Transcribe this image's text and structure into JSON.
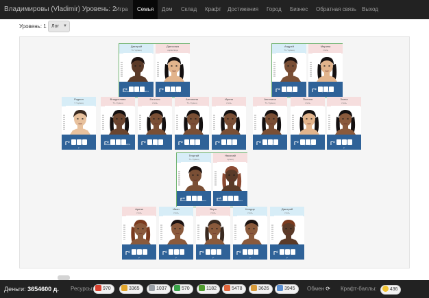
{
  "nav": {
    "brand": "Владимировы (Vladimir) Уровень: 2",
    "items": [
      "Игра",
      "Семья",
      "Дом",
      "Склад",
      "Крафт",
      "Достижения",
      "Город",
      "Бизнес",
      "Обратная связь",
      "Выход"
    ],
    "active": "Семья"
  },
  "level": {
    "label": "Уровень: 1",
    "select_value": "Лог"
  },
  "family": {
    "members": [
      {
        "name": "Дмитрий",
        "status": "71 / кузнец",
        "gender": "male",
        "skin": "#5a3a28",
        "hair": "#1b1210",
        "age": "Г°",
        "job": "Незнакомствовать вместе",
        "job2": ""
      },
      {
        "name": "Джессика",
        "status": "кормилица",
        "gender": "female",
        "skin": "#e2b48c",
        "hair": "#141010",
        "age": "Г°",
        "job": "Незнакомая(1)",
        "job2": ""
      },
      {
        "name": "Андрей",
        "status": "71 / кузнец",
        "gender": "male",
        "skin": "#7a4f35",
        "hair": "#1b1210",
        "age": "Г°",
        "job": "кузнец(1)",
        "job2": ""
      },
      {
        "name": "Марина",
        "status": "стиль",
        "gender": "female",
        "skin": "#e2b48c",
        "hair": "#141010",
        "age": "Г°",
        "job": "кузнец(1)",
        "job2": ""
      },
      {
        "name": "Родион",
        "status": "7 / кузнец",
        "gender": "male",
        "skin": "#e8c19d",
        "hair": "#3a2a20",
        "age": "Г°",
        "job": "",
        "job2": "р"
      },
      {
        "name": "Владислава",
        "status": "71 / кузнец",
        "gender": "female",
        "skin": "#6b452f",
        "hair": "#141010",
        "age": "Г°",
        "job": "Незнакомствовать вместе",
        "job2": ""
      },
      {
        "name": "Евгения",
        "status": "стиль",
        "gender": "female",
        "skin": "#7a4f35",
        "hair": "#141010",
        "age": "Г°",
        "job": "стиль(1)",
        "job2": ""
      },
      {
        "name": "Антонина",
        "status": "71 / кузнец",
        "gender": "female",
        "skin": "#7a4f35",
        "hair": "#141010",
        "age": "Г°",
        "job": "стиль(1)",
        "job2": ""
      },
      {
        "name": "Ирина",
        "status": "стиль",
        "gender": "female",
        "skin": "#7a4f35",
        "hair": "#141010",
        "age": "Г°",
        "job": "стиль(1)",
        "job2": ""
      },
      {
        "name": "Ангелина",
        "status": "71 / кузнец",
        "gender": "female",
        "skin": "#7a4f35",
        "hair": "#141010",
        "age": "Г°",
        "job": "кузнец(1)",
        "job2": ""
      },
      {
        "name": "Полина",
        "status": "стиль",
        "gender": "female",
        "skin": "#e2b48c",
        "hair": "#141010",
        "age": "Г°",
        "job": "кузнец(1)",
        "job2": ""
      },
      {
        "name": "Злата",
        "status": "стиль",
        "gender": "female",
        "skin": "#8a5a3c",
        "hair": "#141010",
        "age": "Г°",
        "job": "",
        "job2": "р"
      },
      {
        "name": "Георгий",
        "status": "71 / кузнец",
        "gender": "male",
        "skin": "#7a4f35",
        "hair": "#1b1210",
        "age": "Г°",
        "job": "Незнакомствовать вместе",
        "job2": ""
      },
      {
        "name": "Николай",
        "status": "кузнец",
        "gender": "female",
        "skin": "#5a3a28",
        "hair": "#8b4a32",
        "age": "Г°",
        "job": "Незнакомствовать вместе",
        "job2": ""
      },
      {
        "name": "Арина",
        "status": "стиль",
        "gender": "female",
        "skin": "#8a5a3c",
        "hair": "#7a3a1e",
        "age": "Г°",
        "job": "",
        "job2": "р"
      },
      {
        "name": "Иван",
        "status": "стиль",
        "gender": "male",
        "skin": "#8a5a3c",
        "hair": "#1b1210",
        "age": "Г°",
        "job": "",
        "job2": "р"
      },
      {
        "name": "Вера",
        "status": "стиль",
        "gender": "female",
        "skin": "#8a5a3c",
        "hair": "#3a2a20",
        "age": "Г°",
        "job": "",
        "job2": "р"
      },
      {
        "name": "Кондор",
        "status": "стиль",
        "gender": "male",
        "skin": "#8a5a3c",
        "hair": "#1b1210",
        "age": "Г°",
        "job": "",
        "job2": "р"
      },
      {
        "name": "Дмитрий",
        "status": "стиль",
        "gender": "male",
        "skin": "#5a3a28",
        "hair": "#7a3a1e",
        "age": "Г°",
        "job": "",
        "job2": "р"
      }
    ]
  },
  "bottom": {
    "money_label": "Деньги:",
    "money_value": "3654600 д.",
    "resources_label": "Ресурсы:",
    "resources": [
      {
        "icon": "apple-icon",
        "color": "#d9412f",
        "value": "970"
      },
      {
        "icon": "bread-icon",
        "color": "#e2a52b",
        "value": "3365"
      },
      {
        "icon": "cloth-icon",
        "color": "#9aa0a6",
        "value": "1037"
      },
      {
        "icon": "recycle-icon",
        "color": "#38a148",
        "value": "570"
      },
      {
        "icon": "grass-icon",
        "color": "#4f9b2e",
        "value": "1182"
      },
      {
        "icon": "brick-icon",
        "color": "#e0643a",
        "value": "5478"
      },
      {
        "icon": "stairs-icon",
        "color": "#d79a3a",
        "value": "3626"
      },
      {
        "icon": "flask-icon",
        "color": "#5b8fd1",
        "value": "3945"
      }
    ],
    "exchange_label": "Обмен",
    "craft_label": "Крафт-баллы:",
    "craft_value": "436"
  },
  "colors": {
    "nav_bg": "#222222",
    "card_bar": "#2f6298",
    "male_header": "#d7edf7",
    "female_header": "#f6dede",
    "pair_border": "#6fb36f"
  }
}
